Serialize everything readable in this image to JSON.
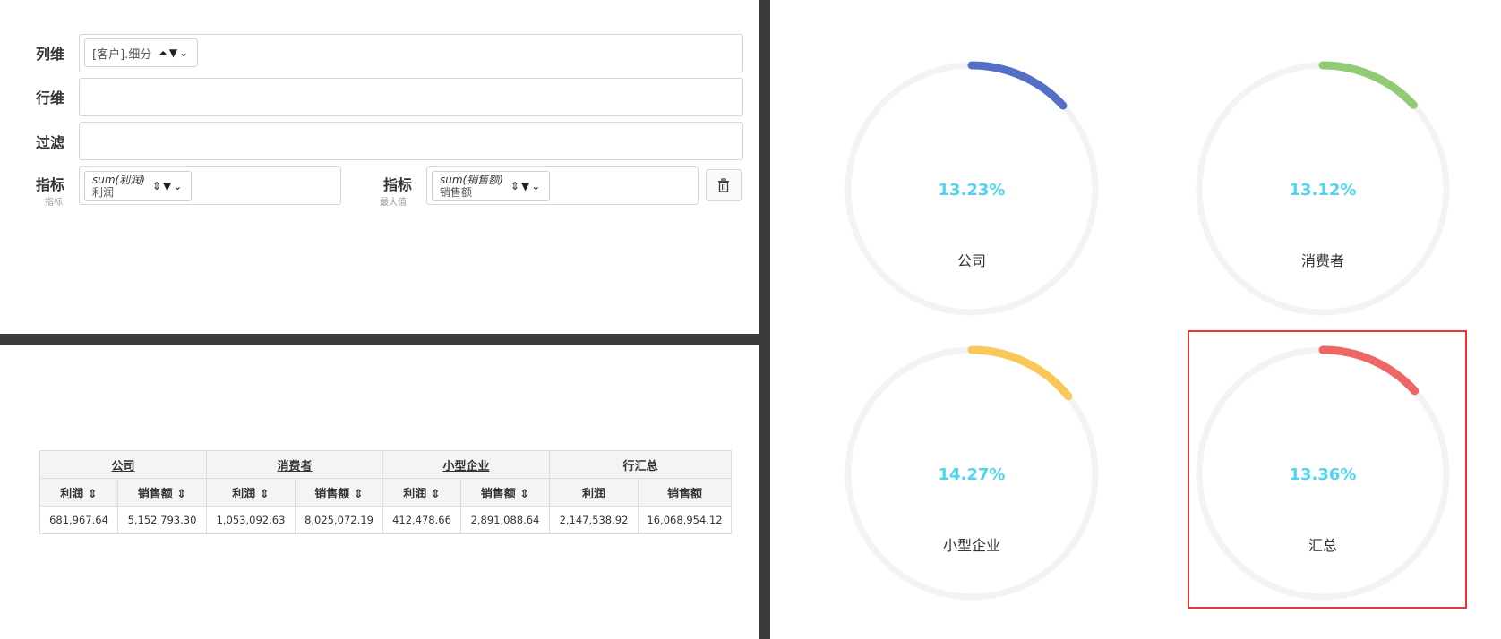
{
  "config": {
    "columns_label": "列维",
    "rows_label": "行维",
    "filter_label": "过滤",
    "column_pill": {
      "text": "[客户].细分",
      "controls": "⏶▼⌄"
    },
    "metric1": {
      "label": "指标",
      "sublabel": "指标",
      "agg": "sum(利润)",
      "field": "利润",
      "controls": "⇕▼⌄"
    },
    "metric2": {
      "label": "指标",
      "sublabel": "最大值",
      "agg": "sum(销售额)",
      "field": "销售额",
      "controls": "⇕▼⌄"
    },
    "trash_icon": "trash-icon"
  },
  "table": {
    "groups": [
      "公司",
      "消费者",
      "小型企业",
      "行汇总"
    ],
    "subheaders": [
      "利润 ⇕",
      "销售额 ⇕",
      "利润 ⇕",
      "销售额 ⇕",
      "利润 ⇕",
      "销售额 ⇕",
      "利润",
      "销售额"
    ],
    "rows": [
      [
        "681,967.64",
        "5,152,793.30",
        "1,053,092.63",
        "8,025,072.19",
        "412,478.66",
        "2,891,088.64",
        "2,147,538.92",
        "16,068,954.12"
      ]
    ]
  },
  "gauges": [
    {
      "label": "公司",
      "percent_text": "13.23%",
      "value": 0.1323,
      "color": "#5470c6"
    },
    {
      "label": "消费者",
      "percent_text": "13.12%",
      "value": 0.1312,
      "color": "#91cc75"
    },
    {
      "label": "小型企业",
      "percent_text": "14.27%",
      "value": 0.1427,
      "color": "#fac858"
    },
    {
      "label": "汇总",
      "percent_text": "13.36%",
      "value": 0.1336,
      "color": "#ee6666"
    }
  ],
  "colors": {
    "track": "#f3f3f3",
    "percent_text": "#4fd4ef",
    "selection": "#e53535"
  }
}
